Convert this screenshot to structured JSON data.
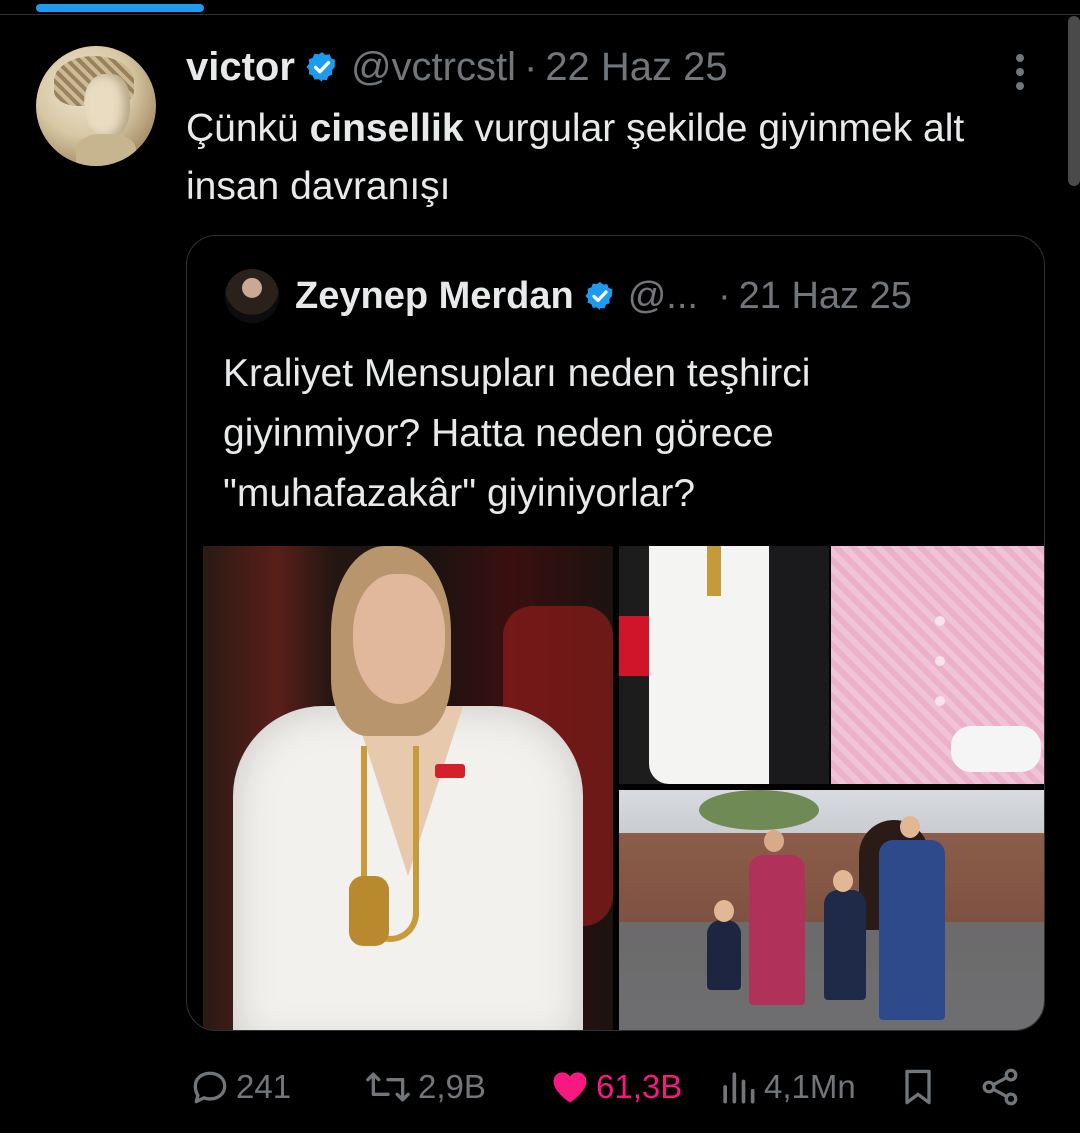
{
  "tweet": {
    "display_name": "victor",
    "handle": "@vctrcstl",
    "separator": "·",
    "date": "22 Haz 25",
    "text_prefix": "Çünkü ",
    "text_bold": "cinsellik",
    "text_suffix": " vurgular şekilde giyinmek alt insan davranışı"
  },
  "quoted": {
    "display_name": "Zeynep Merdan",
    "handle": "@...",
    "separator": "·",
    "date": "21 Haz 25",
    "text": "Kraliyet Mensupları neden teşhirci giyinmiyor? Hatta neden görece \"muhafazakâr\" giyiniyorlar?"
  },
  "actions": {
    "replies": "241",
    "retweets": "2,9B",
    "likes": "61,3B",
    "views": "4,1Mn"
  },
  "icons": {
    "reply": "reply-icon",
    "retweet": "retweet-icon",
    "like": "heart-icon",
    "views": "views-icon",
    "bookmark": "bookmark-icon",
    "share": "share-icon",
    "more": "more-icon",
    "verified": "verified-badge-icon"
  },
  "colors": {
    "accent": "#1d9bf0",
    "like": "#f91880",
    "muted": "#71767b",
    "text": "#e7e9ea",
    "background": "#000000"
  }
}
